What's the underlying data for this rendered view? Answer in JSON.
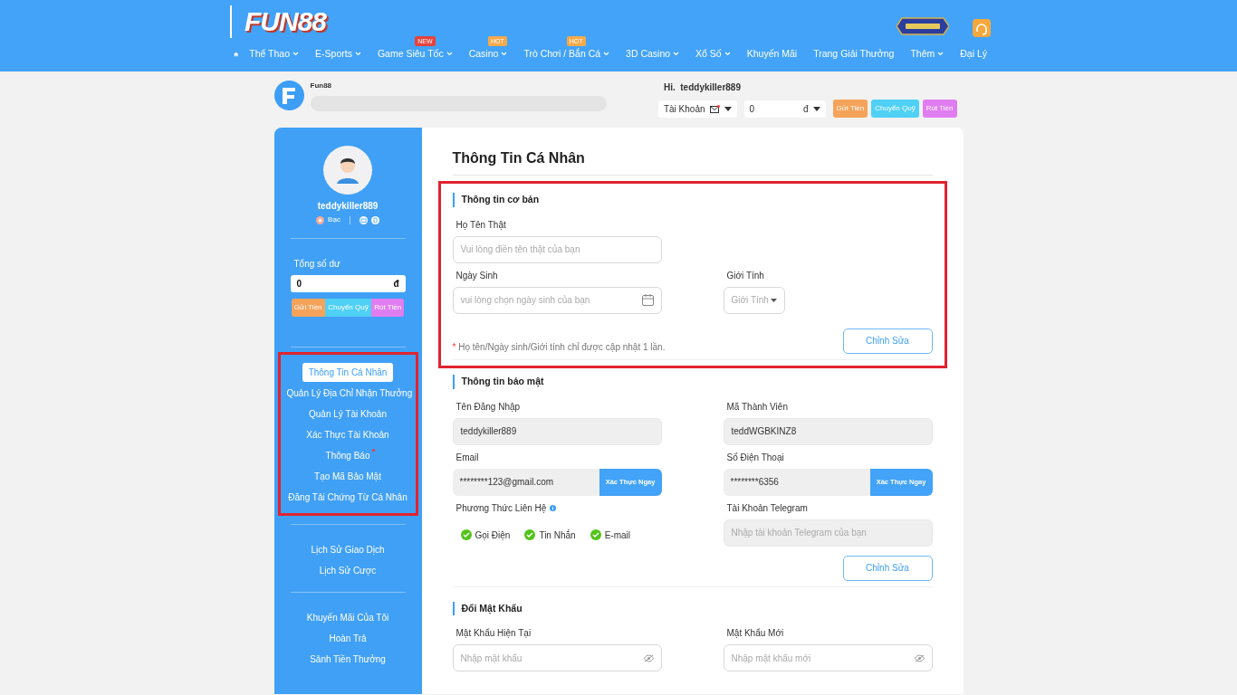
{
  "header": {
    "logo": "FUN88",
    "nav": [
      {
        "label": "Thể Thao",
        "dropdown": true
      },
      {
        "label": "E-Sports",
        "dropdown": true
      },
      {
        "label": "Game Siêu Tốc",
        "dropdown": true,
        "badge": {
          "label": "NEW",
          "color": "#e8413c"
        }
      },
      {
        "label": "Casino",
        "dropdown": true,
        "badge": {
          "label": "HOT",
          "color": "#f5a94a"
        }
      },
      {
        "label": "Trò Chơi / Bắn Cá",
        "dropdown": true,
        "badge": {
          "label": "HOT",
          "color": "#f5a94a"
        }
      },
      {
        "label": "3D Casino",
        "dropdown": true
      },
      {
        "label": "Xổ Số",
        "dropdown": true
      }
    ],
    "nav_right": [
      {
        "label": "Khuyến Mãi",
        "dropdown": false
      },
      {
        "label": "Trang Giải Thưởng",
        "dropdown": false
      },
      {
        "label": "Thêm",
        "dropdown": true
      },
      {
        "label": "Đại Lý",
        "dropdown": false
      }
    ]
  },
  "account_bar": {
    "site": "Fun88",
    "greeting": "Hi.",
    "username": "teddykiller889",
    "account_select": "Tài Khoản",
    "balance": "0",
    "currency": "đ",
    "buttons": [
      {
        "label": "Gửi Tiền",
        "color": "#f5a35a"
      },
      {
        "label": "Chuyển Quỹ",
        "color": "#4fd0f5"
      },
      {
        "label": "Rút Tiền",
        "color": "#e07df0"
      }
    ]
  },
  "profile": {
    "username": "teddykiller889",
    "rank": "Bạc",
    "balance_label": "Tổng số dư",
    "balance": "0",
    "currency": "đ",
    "buttons": [
      {
        "label": "Gửi Tiền",
        "color": "#f5a35a"
      },
      {
        "label": "Chuyển Quỹ",
        "color": "#4fd0f5"
      },
      {
        "label": "Rút Tiền",
        "color": "#e07df0"
      }
    ]
  },
  "menu_groups": [
    {
      "highlighted": true,
      "items": [
        {
          "label": "Thông Tin Cá Nhân",
          "selected": true,
          "dot": false
        },
        {
          "label": "Quản Lý Địa Chỉ Nhận Thưởng",
          "selected": false,
          "dot": false
        },
        {
          "label": "Quản Lý Tài Khoản",
          "selected": false,
          "dot": false
        },
        {
          "label": "Xác Thực Tài Khoản",
          "selected": false,
          "dot": false
        },
        {
          "label": "Thông Báo",
          "selected": false,
          "dot": true
        },
        {
          "label": "Tạo Mã Bảo Mật",
          "selected": false,
          "dot": false
        },
        {
          "label": "Đăng Tải Chứng Từ Cá Nhân",
          "selected": false,
          "dot": false
        }
      ]
    },
    {
      "highlighted": false,
      "items": [
        {
          "label": "Lịch Sử Giao Dịch",
          "selected": false,
          "dot": false
        },
        {
          "label": "Lịch Sử Cược",
          "selected": false,
          "dot": false
        }
      ]
    },
    {
      "highlighted": false,
      "items": [
        {
          "label": "Khuyến Mãi Của Tôi",
          "selected": false,
          "dot": false
        },
        {
          "label": "Hoàn Trả",
          "selected": false,
          "dot": false
        },
        {
          "label": "Sảnh Tiền Thưởng",
          "selected": false,
          "dot": false
        }
      ]
    }
  ],
  "page_title": "Thông Tin Cá Nhân",
  "sections": [
    {
      "title": "Thông tin cơ bản",
      "highlighted": true,
      "rows": [
        [
          {
            "kind": "text",
            "label": "Họ Tên Thật",
            "placeholder": "Vui lòng điền tên thật của bạn"
          }
        ],
        [
          {
            "kind": "date",
            "label": "Ngày Sinh",
            "placeholder": "vui lòng chọn ngày sinh của bạn"
          },
          {
            "kind": "select",
            "label": "Giới Tính",
            "placeholder": "Giới Tính"
          }
        ]
      ],
      "note_mark": "*",
      "note": "Họ tên/Ngày sinh/Giới tính chỉ được cập nhật 1 lần.",
      "button": "Chỉnh Sửa"
    },
    {
      "title": "Thông tin bảo mật",
      "highlighted": false,
      "rows": [
        [
          {
            "kind": "readonly",
            "label": "Tên Đăng Nhập",
            "value": "teddykiller889"
          },
          {
            "kind": "readonly",
            "label": "Mã Thành Viên",
            "value": "teddWGBKINZ8"
          }
        ],
        [
          {
            "kind": "verify",
            "label": "Email",
            "value": "********123@gmail.com",
            "action": "Xác Thực Ngay"
          },
          {
            "kind": "verify",
            "label": "Số Điện Thoại",
            "value": "********6356",
            "action": "Xác Thực Ngay"
          }
        ],
        [
          {
            "kind": "checks",
            "label": "Phương Thức Liên Hệ",
            "options": [
              {
                "label": "Gọi Điện",
                "checked": true
              },
              {
                "label": "Tin Nhắn",
                "checked": true
              },
              {
                "label": "E-mail",
                "checked": true
              }
            ]
          },
          {
            "kind": "readonly",
            "label": "Tài Khoản Telegram",
            "placeholder": "Nhập tài khoản Telegram của bạn"
          }
        ]
      ],
      "button": "Chỉnh Sửa"
    },
    {
      "title": "Đổi Mật Khẩu",
      "highlighted": false,
      "rows": [
        [
          {
            "kind": "password",
            "label": "Mật Khẩu Hiện Tại",
            "placeholder": "Nhập mật khẩu"
          },
          {
            "kind": "password",
            "label": "Mật Khẩu Mới",
            "placeholder": "Nhập mật khẩu mới"
          }
        ]
      ]
    }
  ]
}
